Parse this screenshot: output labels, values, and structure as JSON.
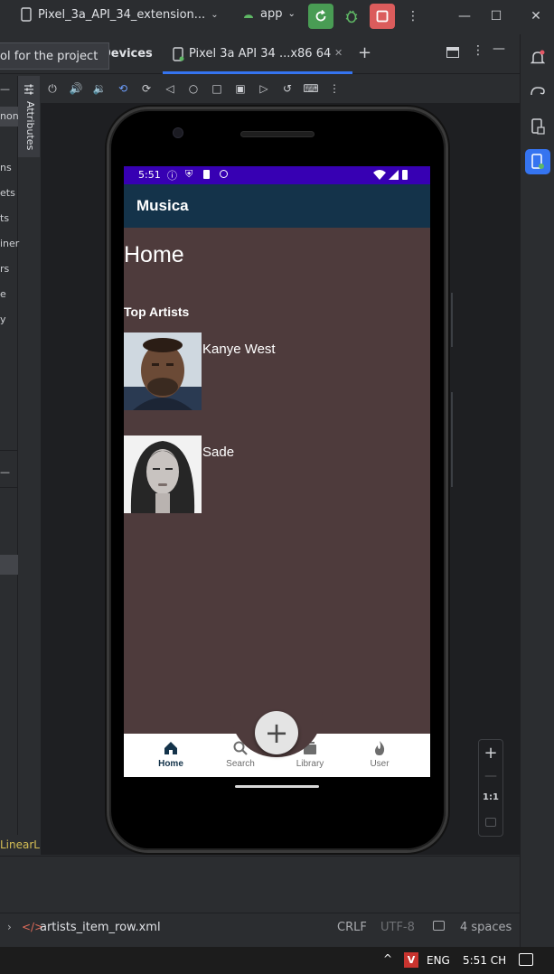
{
  "titlebar": {
    "device_selector": "Pixel_3a_API_34_extension...",
    "run_config": "app"
  },
  "tabs": {
    "tooltip": "ol for the project",
    "devices_label": "Devices",
    "device_tab": "Pixel 3a API 34 ...x86 64"
  },
  "left_panel": {
    "attributes_label": "Attributes",
    "items": [
      "non",
      "ns",
      "ets",
      "ts",
      "iner",
      "rs",
      "e",
      "y"
    ],
    "breadcrumb": "LinearL"
  },
  "phone": {
    "status_time": "5:51",
    "app_title": "Musica",
    "heading": "Home",
    "subheading": "Top Artists",
    "artists": [
      {
        "name": "Kanye West"
      },
      {
        "name": "Sade"
      }
    ],
    "fab_symbol": "+",
    "nav": [
      {
        "label": "Home",
        "icon": "home-icon",
        "active": true
      },
      {
        "label": "Search",
        "icon": "search-icon",
        "active": false
      },
      {
        "label": "Library",
        "icon": "library-icon",
        "active": false
      },
      {
        "label": "User",
        "icon": "flame-icon",
        "active": false
      }
    ]
  },
  "zoom": {
    "plus": "+",
    "minus": "—",
    "reset": "1:1"
  },
  "statusline": {
    "file": "artists_item_row.xml",
    "line_sep": "CRLF",
    "encoding": "UTF-8",
    "indent": "4 spaces"
  },
  "taskbar": {
    "lang": "ENG",
    "clock": "5:51 CH"
  },
  "colors": {
    "status_bar": "#3700b3",
    "app_bar": "#14334a",
    "screen_bg": "#4e3b3c",
    "run_green": "#499c54",
    "stop_red": "#db5c5c",
    "active_blue": "#3574f0"
  }
}
